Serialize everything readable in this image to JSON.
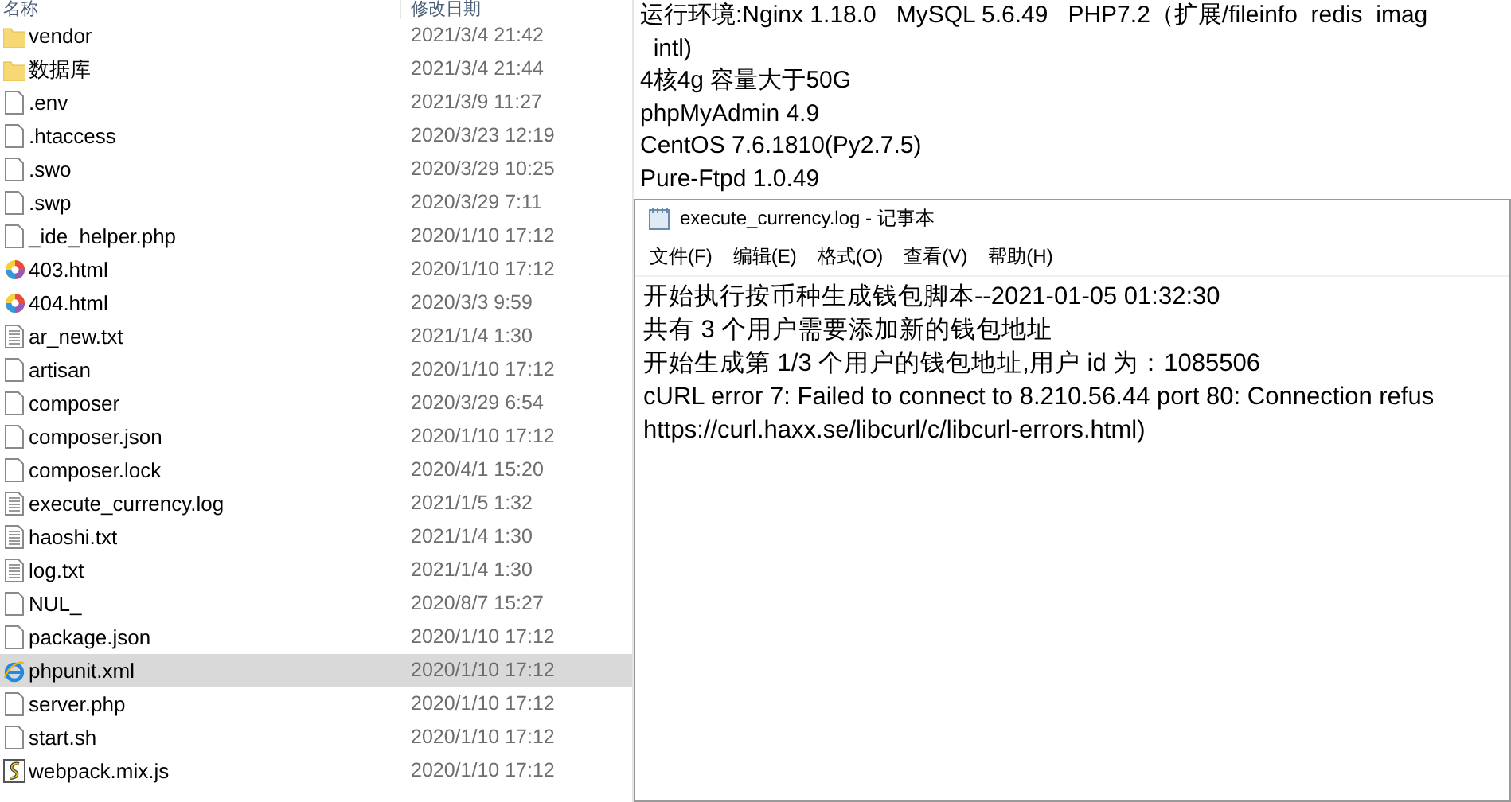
{
  "explorer": {
    "columns": [
      "名称",
      "修改日期"
    ],
    "rows": [
      {
        "name": "vendor",
        "date": "2021/3/4 21:42",
        "kind": "folder",
        "selected": false
      },
      {
        "name": "数据库",
        "date": "2021/3/4 21:44",
        "kind": "folder",
        "selected": false
      },
      {
        "name": ".env",
        "date": "2021/3/9 11:27",
        "kind": "file",
        "selected": false
      },
      {
        "name": ".htaccess",
        "date": "2020/3/23 12:19",
        "kind": "file",
        "selected": false
      },
      {
        "name": ".swo",
        "date": "2020/3/29 10:25",
        "kind": "file",
        "selected": false
      },
      {
        "name": ".swp",
        "date": "2020/3/29 7:11",
        "kind": "file",
        "selected": false
      },
      {
        "name": "_ide_helper.php",
        "date": "2020/1/10 17:12",
        "kind": "file",
        "selected": false
      },
      {
        "name": "403.html",
        "date": "2020/1/10 17:12",
        "kind": "web",
        "selected": false
      },
      {
        "name": "404.html",
        "date": "2020/3/3 9:59",
        "kind": "web",
        "selected": false
      },
      {
        "name": "ar_new.txt",
        "date": "2021/1/4 1:30",
        "kind": "text",
        "selected": false
      },
      {
        "name": "artisan",
        "date": "2020/1/10 17:12",
        "kind": "file",
        "selected": false
      },
      {
        "name": "composer",
        "date": "2020/3/29 6:54",
        "kind": "file",
        "selected": false
      },
      {
        "name": "composer.json",
        "date": "2020/1/10 17:12",
        "kind": "file",
        "selected": false
      },
      {
        "name": "composer.lock",
        "date": "2020/4/1 15:20",
        "kind": "file",
        "selected": false
      },
      {
        "name": "execute_currency.log",
        "date": "2021/1/5 1:32",
        "kind": "text",
        "selected": false
      },
      {
        "name": "haoshi.txt",
        "date": "2021/1/4 1:30",
        "kind": "text",
        "selected": false
      },
      {
        "name": "log.txt",
        "date": "2021/1/4 1:30",
        "kind": "text",
        "selected": false
      },
      {
        "name": "NUL_",
        "date": "2020/8/7 15:27",
        "kind": "file",
        "selected": false
      },
      {
        "name": "package.json",
        "date": "2020/1/10 17:12",
        "kind": "file",
        "selected": false
      },
      {
        "name": "phpunit.xml",
        "date": "2020/1/10 17:12",
        "kind": "browser",
        "selected": true
      },
      {
        "name": "server.php",
        "date": "2020/1/10 17:12",
        "kind": "file",
        "selected": false
      },
      {
        "name": "start.sh",
        "date": "2020/1/10 17:12",
        "kind": "file",
        "selected": false
      },
      {
        "name": "webpack.mix.js",
        "date": "2020/1/10 17:12",
        "kind": "script",
        "selected": false
      }
    ]
  },
  "notes": [
    "运行环境:Nginx 1.18.0   MySQL 5.6.49   PHP7.2（扩展/fileinfo  redis  imag",
    "  intl)",
    "4核4g 容量大于50G",
    "phpMyAdmin 4.9",
    "CentOS 7.6.1810(Py2.7.5)",
    "Pure-Ftpd 1.0.49"
  ],
  "notepad": {
    "title": "execute_currency.log - 记事本",
    "menu": [
      "文件(F)",
      "编辑(E)",
      "格式(O)",
      "查看(V)",
      "帮助(H)"
    ],
    "lines": [
      "开始执行按币种生成钱包脚本--2021-01-05 01:32:30",
      "共有 3 个用户需要添加新的钱包地址",
      "开始生成第 1/3 个用户的钱包地址,用户 id 为：1085506",
      "cURL error 7: Failed to connect to 8.210.56.44 port 80: Connection refus",
      "https://curl.haxx.se/libcurl/c/libcurl-errors.html)"
    ]
  }
}
